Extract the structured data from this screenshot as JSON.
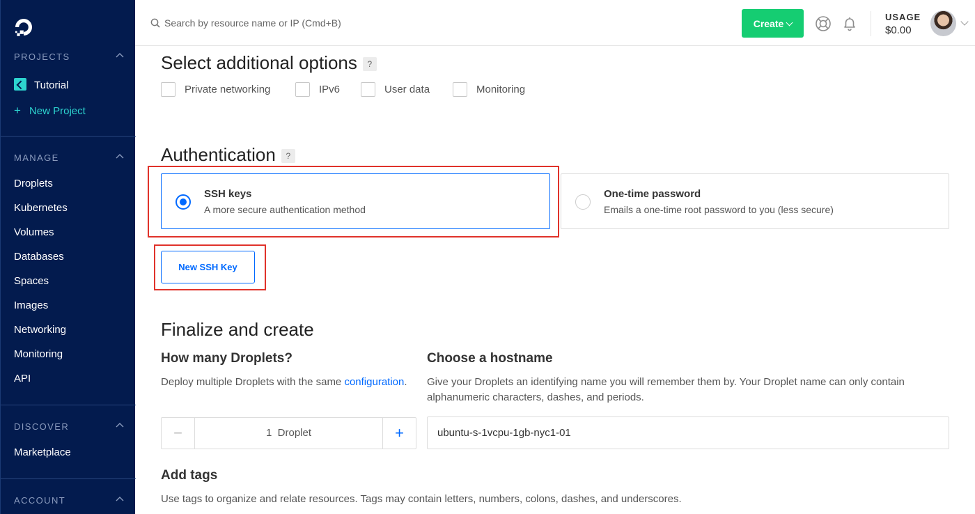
{
  "colors": {
    "sidebar_bg": "#031b4e",
    "accent": "#0069ff",
    "create_green": "#15cd72",
    "teal": "#2dd4cf",
    "highlight_red": "#e0322a"
  },
  "sidebar": {
    "logo_icon": "digitalocean-logo-icon",
    "projects_heading": "PROJECTS",
    "projects": [
      {
        "label": "Tutorial"
      }
    ],
    "new_project_label": "New Project",
    "manage_heading": "MANAGE",
    "manage_items": [
      {
        "label": "Droplets"
      },
      {
        "label": "Kubernetes"
      },
      {
        "label": "Volumes"
      },
      {
        "label": "Databases"
      },
      {
        "label": "Spaces"
      },
      {
        "label": "Images"
      },
      {
        "label": "Networking"
      },
      {
        "label": "Monitoring"
      },
      {
        "label": "API"
      }
    ],
    "discover_heading": "DISCOVER",
    "discover_items": [
      {
        "label": "Marketplace"
      }
    ],
    "account_heading": "ACCOUNT"
  },
  "header": {
    "search_placeholder": "Search by resource name or IP (Cmd+B)",
    "create_label": "Create",
    "usage_label": "USAGE",
    "usage_value": "$0.00"
  },
  "options": {
    "title": "Select additional options",
    "help": "?",
    "checkboxes": [
      {
        "label": "Private networking",
        "checked": false
      },
      {
        "label": "IPv6",
        "checked": false
      },
      {
        "label": "User data",
        "checked": false
      },
      {
        "label": "Monitoring",
        "checked": false
      }
    ]
  },
  "authentication": {
    "title": "Authentication",
    "help": "?",
    "methods": [
      {
        "title": "SSH keys",
        "subtitle": "A more secure authentication method",
        "selected": true
      },
      {
        "title": "One-time password",
        "subtitle": "Emails a one-time root password to you (less secure)",
        "selected": false
      }
    ],
    "new_key_label": "New SSH Key"
  },
  "finalize": {
    "title": "Finalize and create",
    "count": {
      "heading": "How many Droplets?",
      "description": "Deploy multiple Droplets with the same ",
      "link": "configuration",
      "description_end": ".",
      "value": "1  Droplet",
      "minus": "−",
      "plus": "+"
    },
    "hostname": {
      "heading": "Choose a hostname",
      "description_line1": "Give your Droplets an identifying name you will remember them by. Your Droplet name can only contain",
      "description_line2": "alphanumeric characters, dashes, and periods.",
      "value": "ubuntu-s-1vcpu-1gb-nyc1-01"
    },
    "tags": {
      "heading": "Add tags",
      "description": "Use tags to organize and relate resources. Tags may contain letters, numbers, colons, dashes, and underscores."
    }
  }
}
